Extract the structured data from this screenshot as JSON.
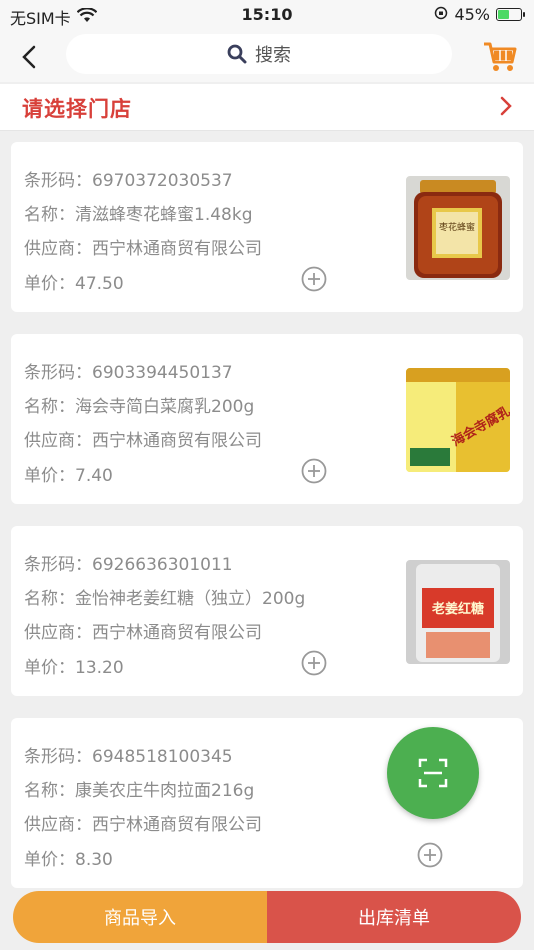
{
  "status": {
    "carrier": "无SIM卡",
    "time": "15:10",
    "battery": "45%",
    "battery_level": 0.45
  },
  "nav": {
    "search_label": "搜索"
  },
  "store": {
    "label": "请选择门店"
  },
  "labels": {
    "barcode": "条形码：",
    "name": "名称：",
    "supplier": "供应商：",
    "price": "单价："
  },
  "products": [
    {
      "barcode": "6970372030537",
      "name": "清滋蜂枣花蜂蜜1.48kg",
      "supplier": "西宁林通商贸有限公司",
      "price": "47.50",
      "image": "honey-jar",
      "image_text": "枣花蜂蜜"
    },
    {
      "barcode": "6903394450137",
      "name": "海会寺简白菜腐乳200g",
      "supplier": "西宁林通商贸有限公司",
      "price": "7.40",
      "image": "tofu-box",
      "image_text": "海会寺腐乳"
    },
    {
      "barcode": "6926636301011",
      "name": "金怡神老姜红糖（独立）200g",
      "supplier": "西宁林通商贸有限公司",
      "price": "13.20",
      "image": "sugar-bag",
      "image_text": "老姜红糖"
    },
    {
      "barcode": "6948518100345",
      "name": "康美农庄牛肉拉面216g",
      "supplier": "西宁林通商贸有限公司",
      "price": "8.30",
      "image": null,
      "image_text": ""
    }
  ],
  "bottom": {
    "import_label": "商品导入",
    "outbound_label": "出库清单"
  },
  "colors": {
    "accent_red": "#d8403a",
    "orange": "#f0a43a",
    "green": "#4caf50",
    "cart": "#f08a24"
  }
}
